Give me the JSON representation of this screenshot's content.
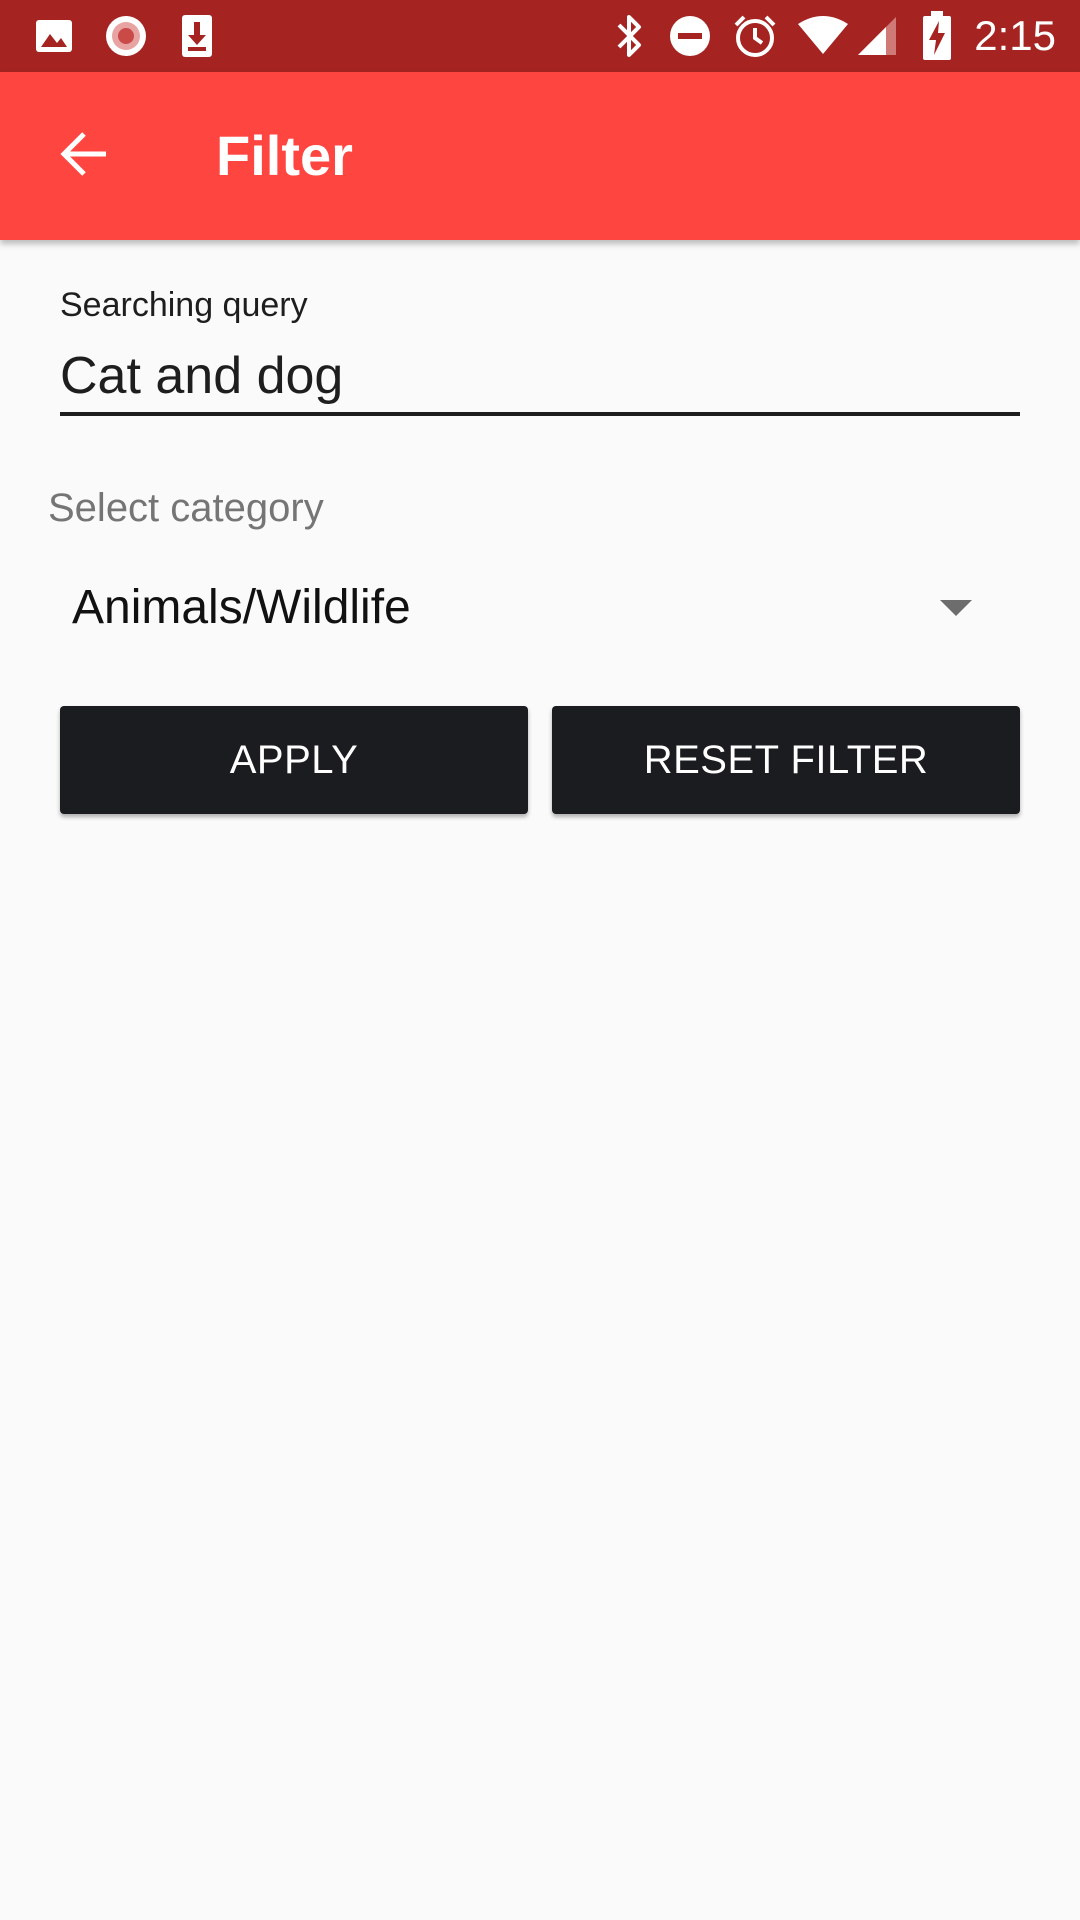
{
  "status_bar": {
    "time": "2:15",
    "left_icons": [
      "image-icon",
      "record-icon",
      "download-icon"
    ],
    "right_icons": [
      "bluetooth-icon",
      "do-not-disturb-icon",
      "alarm-icon",
      "wifi-icon",
      "cell-signal-icon",
      "battery-charging-icon"
    ],
    "background": "#a52422"
  },
  "app_bar": {
    "title": "Filter",
    "back_icon": "arrow-back-icon",
    "background": "#ff4540"
  },
  "form": {
    "query_label": "Searching query",
    "query_value": "Cat and dog",
    "category_label": "Select category",
    "category_value": "Animals/Wildlife"
  },
  "buttons": {
    "apply_label": "APPLY",
    "reset_label": "RESET FILTER",
    "color": "#1b1c20"
  }
}
